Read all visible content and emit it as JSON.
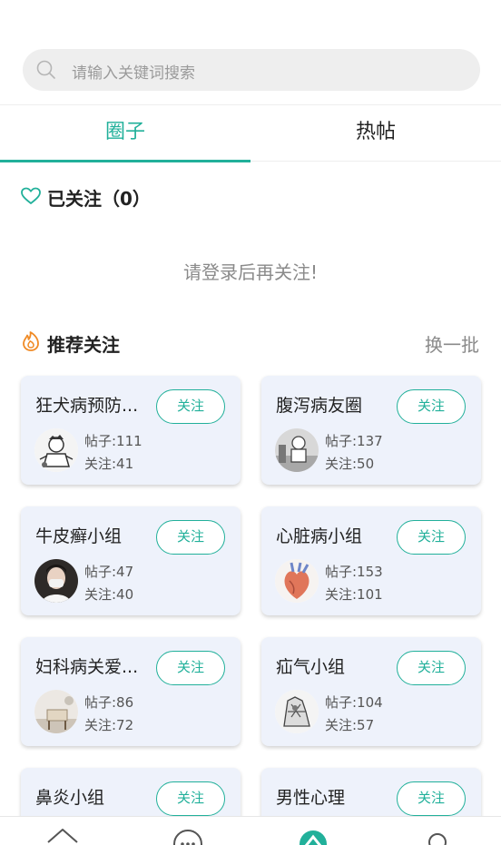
{
  "search": {
    "placeholder": "请输入关键词搜索"
  },
  "tabs": [
    {
      "label": "圈子",
      "active": true
    },
    {
      "label": "热帖",
      "active": false
    }
  ],
  "followed": {
    "title": "已关注（0）",
    "empty_message": "请登录后再关注!"
  },
  "recommend": {
    "title": "推荐关注",
    "refresh_label": "换一批"
  },
  "groups": [
    {
      "name": "狂犬病预防...",
      "follow": "关注",
      "posts": "帖子:111",
      "fans": "关注:41"
    },
    {
      "name": "腹泻病友圈",
      "follow": "关注",
      "posts": "帖子:137",
      "fans": "关注:50"
    },
    {
      "name": "牛皮癣小组",
      "follow": "关注",
      "posts": "帖子:47",
      "fans": "关注:40"
    },
    {
      "name": "心脏病小组",
      "follow": "关注",
      "posts": "帖子:153",
      "fans": "关注:101"
    },
    {
      "name": "妇科病关爱...",
      "follow": "关注",
      "posts": "帖子:86",
      "fans": "关注:72"
    },
    {
      "name": "疝气小组",
      "follow": "关注",
      "posts": "帖子:104",
      "fans": "关注:57"
    },
    {
      "name": "鼻炎小组",
      "follow": "关注",
      "posts": "",
      "fans": ""
    },
    {
      "name": "男性心理",
      "follow": "关注",
      "posts": "",
      "fans": ""
    }
  ],
  "nav": [
    {
      "icon": "home-icon"
    },
    {
      "icon": "chat-icon"
    },
    {
      "icon": "community-icon",
      "active": true
    },
    {
      "icon": "profile-icon"
    }
  ],
  "colors": {
    "accent": "#21b09a",
    "card_bg": "#eef2fb",
    "hot": "#f08a24"
  }
}
